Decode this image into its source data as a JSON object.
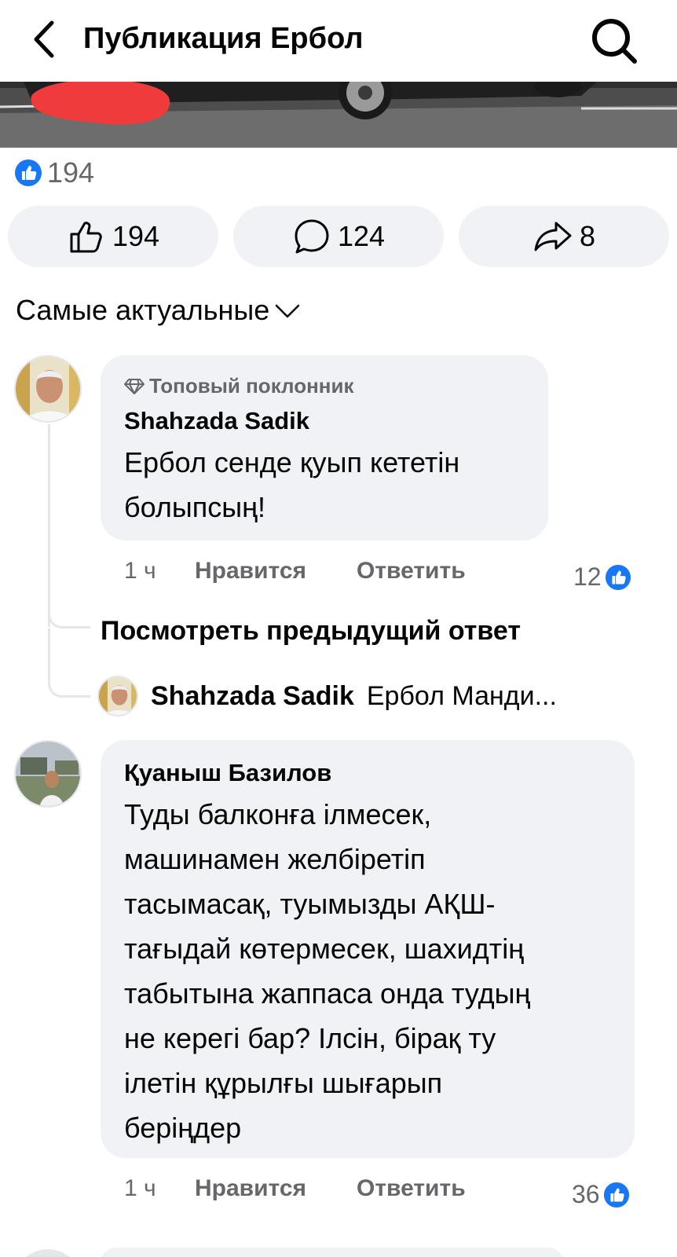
{
  "header": {
    "title": "Публикация Ербол",
    "back_icon": "chevron-left-icon",
    "search_icon": "search-icon"
  },
  "post": {
    "reaction_count": "194",
    "actions": {
      "like_count": "194",
      "comment_count": "124",
      "share_count": "8"
    }
  },
  "sort": {
    "label": "Самые актуальные"
  },
  "comments": [
    {
      "badge": "Топовый поклонник",
      "author": "Shahzada Sadik",
      "text": "Ербол сенде қуып кететін\nболыпсың!",
      "time": "1 ч",
      "like_label": "Нравится",
      "reply_label": "Ответить",
      "reactions": "12"
    },
    {
      "author": "Қуаныш Базилов",
      "text": "Туды балконға ілмесек,\nмашинамен желбіретіп\nтасымасақ, туымызды АҚШ-\nтағыдай көтермесек, шахидтің\nтабытына жаппаса онда тудың\nне керегі бар? Ілсін, бірақ ту\nілетін құрылғы шығарып\nберіңдер",
      "time": "1 ч",
      "like_label": "Нравится",
      "reply_label": "Ответить",
      "reactions": "36"
    }
  ],
  "thread": {
    "view_previous": "Посмотреть предыдущий ответ",
    "reply_author": "Shahzada Sadik",
    "reply_text": "Ербол Манди..."
  },
  "colors": {
    "like_blue": "#1877f2",
    "bubble_bg": "#f0f2f5",
    "secondary_text": "#65676b"
  }
}
